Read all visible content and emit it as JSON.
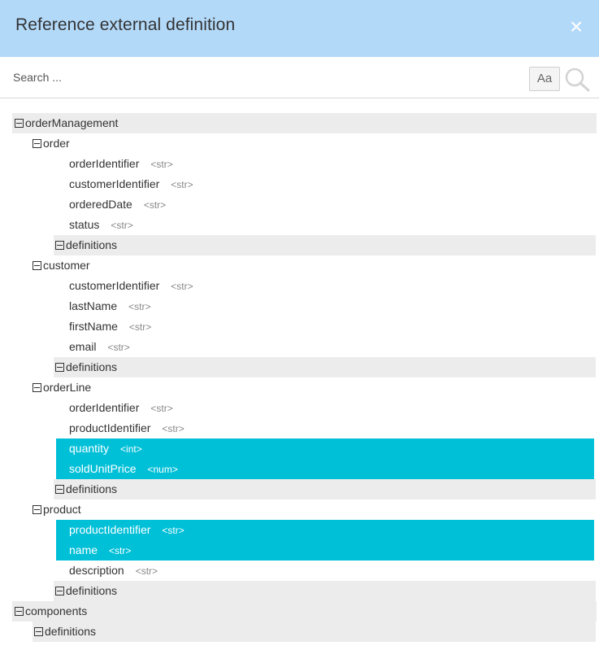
{
  "dialog": {
    "title": "Reference external definition",
    "close_symbol": "×"
  },
  "search": {
    "placeholder": "Search ...",
    "case_label": "Aa"
  },
  "tree": {
    "r0": {
      "label": "orderManagement"
    },
    "r1": {
      "label": "order"
    },
    "r2": {
      "label": "orderIdentifier",
      "type": "<str>"
    },
    "r3": {
      "label": "customerIdentifier",
      "type": "<str>"
    },
    "r4": {
      "label": "orderedDate",
      "type": "<str>"
    },
    "r5": {
      "label": "status",
      "type": "<str>"
    },
    "r6": {
      "label": "definitions"
    },
    "r7": {
      "label": "customer"
    },
    "r8": {
      "label": "customerIdentifier",
      "type": "<str>"
    },
    "r9": {
      "label": "lastName",
      "type": "<str>"
    },
    "r10": {
      "label": "firstName",
      "type": "<str>"
    },
    "r11": {
      "label": "email",
      "type": "<str>"
    },
    "r12": {
      "label": "definitions"
    },
    "r13": {
      "label": "orderLine"
    },
    "r14": {
      "label": "orderIdentifier",
      "type": "<str>"
    },
    "r15": {
      "label": "productIdentifier",
      "type": "<str>"
    },
    "r16": {
      "label": "quantity",
      "type": "<int>"
    },
    "r17": {
      "label": "soldUnitPrice",
      "type": "<num>"
    },
    "r18": {
      "label": "definitions"
    },
    "r19": {
      "label": "product"
    },
    "r20": {
      "label": "productIdentifier",
      "type": "<str>"
    },
    "r21": {
      "label": "name",
      "type": "<str>"
    },
    "r22": {
      "label": "description",
      "type": "<str>"
    },
    "r23": {
      "label": "definitions"
    },
    "r24": {
      "label": "components"
    },
    "r25": {
      "label": "definitions"
    }
  },
  "colors": {
    "header": "#b3d9f9",
    "selection": "#00c0d8",
    "group_row": "#ececec"
  }
}
